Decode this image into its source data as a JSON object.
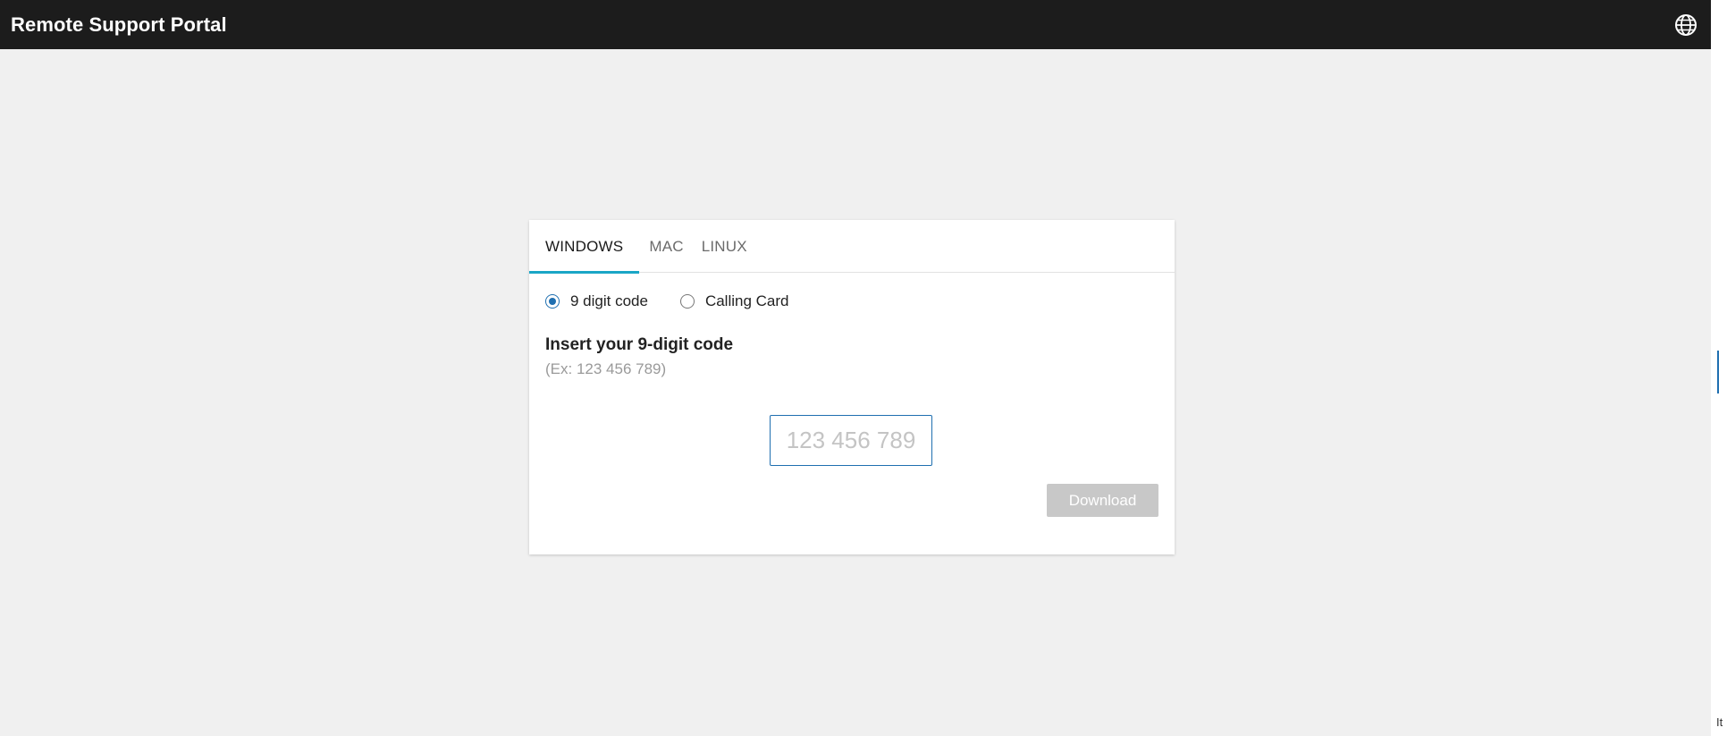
{
  "header": {
    "title": "Remote Support Portal",
    "language_icon": "globe-icon"
  },
  "tabs": [
    {
      "label": "WINDOWS",
      "active": true
    },
    {
      "label": "MAC",
      "active": false
    },
    {
      "label": "LINUX",
      "active": false
    }
  ],
  "code_type": {
    "options": [
      {
        "label": "9 digit code",
        "selected": true
      },
      {
        "label": "Calling Card",
        "selected": false
      }
    ]
  },
  "form": {
    "heading": "Insert your 9-digit code",
    "example": "(Ex: 123 456 789)",
    "input_value": "",
    "input_placeholder": "123 456 789",
    "download_label": "Download",
    "download_enabled": false
  },
  "edge": {
    "corner_text": "It"
  },
  "colors": {
    "topbar": "#1c1c1c",
    "accent_tab": "#1aa6c6",
    "accent_blue": "#1f6fb0",
    "button_disabled": "#c8c8c8",
    "page_background": "#f0f0f0"
  }
}
